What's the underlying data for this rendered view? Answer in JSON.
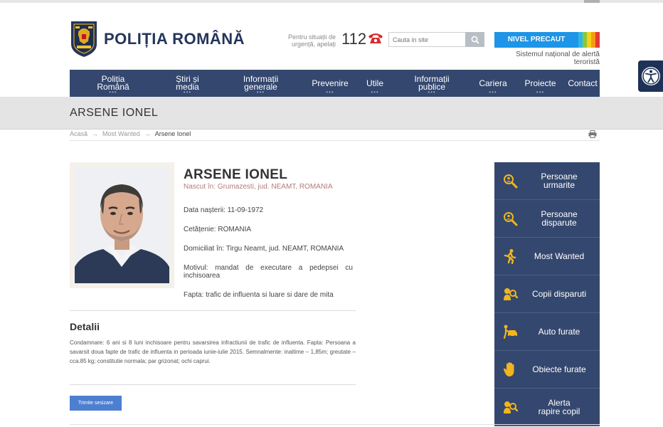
{
  "header": {
    "brand": "POLIȚIA ROMÂNĂ",
    "emergency_text": "Pentru situații de urgență, apelați",
    "emergency_number": "112",
    "search_placeholder": "Cauta in site",
    "alert_level": "NIVEL PRECAUT",
    "alert_subtitle": "Sistemul național de alertă teroristă",
    "alert_colors": [
      "#2fb6e8",
      "#8cc63f",
      "#f7d117",
      "#f39c12",
      "#e53935"
    ]
  },
  "nav": [
    {
      "label": "Poliția Română",
      "dots": true
    },
    {
      "label": "Știri și media",
      "dots": true
    },
    {
      "label": "Informații generale",
      "dots": true
    },
    {
      "label": "Prevenire",
      "dots": true
    },
    {
      "label": "Utile",
      "dots": true
    },
    {
      "label": "Informații publice",
      "dots": true
    },
    {
      "label": "Cariera",
      "dots": true
    },
    {
      "label": "Proiecte",
      "dots": true
    },
    {
      "label": "Contact",
      "dots": false
    }
  ],
  "page": {
    "title": "ARSENE IONEL"
  },
  "breadcrumb": {
    "home": "Acasă",
    "section": "Most Wanted",
    "current": "Arsene Ionel"
  },
  "profile": {
    "name": "ARSENE IONEL",
    "born": "Nascut în: Grumazesti, jud. NEAMT, ROMANIA",
    "birth_date": "Data nașterii: 11-09-1972",
    "citizenship": "Cetățenie: ROMANIA",
    "residence": "Domiciliat în: Tirgu Neamt, jud. NEAMT, ROMANIA",
    "reason": "Motivul: mandat de executare a pedepsei cu inchisoarea",
    "offense": "Fapta: trafic de influenta si luare si dare de mita"
  },
  "details": {
    "heading": "Detalii",
    "text": "Condamnare: 6 ani si 8 luni inchisoare pentru savarsirea infractiunii de trafic de influenta. Fapta: Persoana a savarsit doua fapte de trafic de influenta in perioada iunie-iulie 2015. Semnalmente: inaltime – 1,85m; greutate – cca.85 kg; constitutie normala; par grizonat; ochi caprui.",
    "button": "Trimite sesizare"
  },
  "sidebar": [
    {
      "label": "Persoane urmarite",
      "icon": "search-person-icon"
    },
    {
      "label": "Persoane disparute",
      "icon": "search-person-icon"
    },
    {
      "label": "Most Wanted",
      "icon": "running-man-icon"
    },
    {
      "label": "Copii disparuti",
      "icon": "child-search-icon"
    },
    {
      "label": "Auto furate",
      "icon": "car-thief-icon"
    },
    {
      "label": "Obiecte furate",
      "icon": "hand-icon"
    },
    {
      "label": "Alerta rapire copil",
      "icon": "child-alert-icon"
    }
  ]
}
